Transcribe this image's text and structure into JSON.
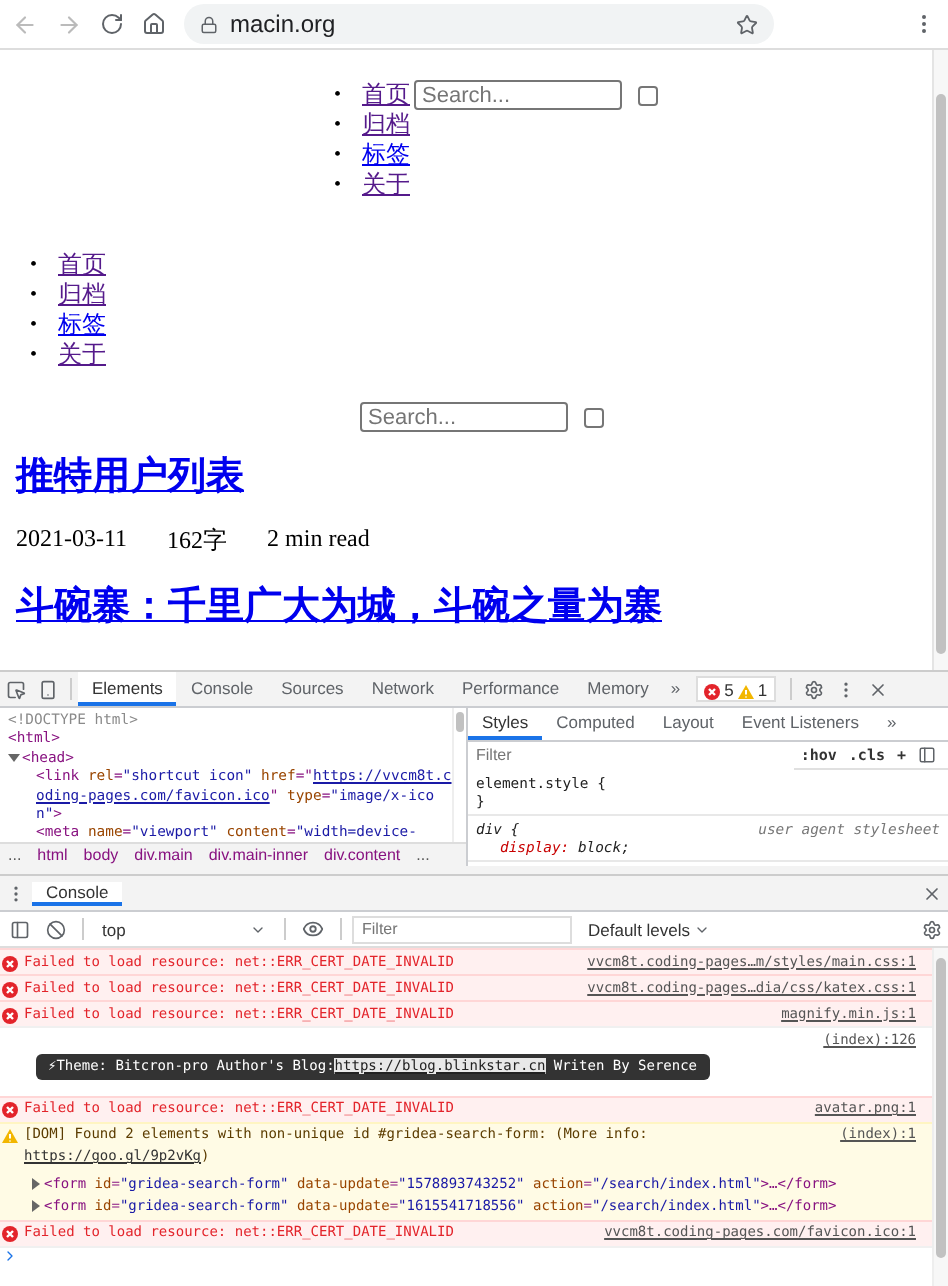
{
  "browser": {
    "address": "macin.org"
  },
  "page": {
    "header_nav": {
      "links": [
        {
          "marker": "•",
          "label": "首页",
          "visited": true
        },
        {
          "marker": "•",
          "label": "归档",
          "visited": true
        },
        {
          "marker": "•",
          "label": "标签",
          "visited": false
        },
        {
          "marker": "•",
          "label": "关于",
          "visited": true
        }
      ],
      "search": {
        "placeholder": "Search...",
        "checked": false
      }
    },
    "menu": {
      "links": [
        {
          "marker": "•",
          "label": "首页",
          "visited": true
        },
        {
          "marker": "•",
          "label": "归档",
          "visited": true
        },
        {
          "marker": "•",
          "label": "标签",
          "visited": false
        },
        {
          "marker": "•",
          "label": "关于",
          "visited": true
        }
      ]
    },
    "search": {
      "placeholder": "Search...",
      "checked": false
    },
    "posts": [
      {
        "title": "推特用户列表",
        "date": "2021-03-11",
        "words": "162字",
        "read_time": "2 min read"
      },
      {
        "title": "斗碗寨：千里广大为城，斗碗之量为寨"
      }
    ]
  },
  "devtools": {
    "tabs": [
      {
        "label": "Elements",
        "selected": true
      },
      {
        "label": "Console",
        "selected": false
      },
      {
        "label": "Sources",
        "selected": false
      },
      {
        "label": "Network",
        "selected": false
      },
      {
        "label": "Performance",
        "selected": false
      },
      {
        "label": "Memory",
        "selected": false
      }
    ],
    "overflow": "»",
    "error_count": "5",
    "warning_count": "1",
    "dom": [
      {
        "tokens": [
          {
            "kind": "comment",
            "text": "<!DOCTYPE html>"
          }
        ]
      },
      {
        "tokens": [
          {
            "kind": "tag",
            "text": "<html>"
          }
        ],
        "children": [
          {
            "tokens": [
              {
                "kind": "tag",
                "text": "<head>"
              }
            ],
            "expanded": true,
            "children": [
              {
                "tokens": [
                  {
                    "kind": "tag",
                    "text": "<link"
                  },
                  {
                    "kind": "attr",
                    "text": " rel"
                  },
                  {
                    "kind": "tag",
                    "text": "="
                  },
                  {
                    "kind": "value",
                    "text": "\"shortcut icon\""
                  },
                  {
                    "kind": "attr",
                    "text": " href"
                  },
                  {
                    "kind": "tag",
                    "text": "=\""
                  },
                  {
                    "kind": "link",
                    "text": "https://vvcm8t.coding-pages.com/favicon.ico"
                  },
                  {
                    "kind": "tag",
                    "text": "\""
                  },
                  {
                    "kind": "attr",
                    "text": " type"
                  },
                  {
                    "kind": "tag",
                    "text": "="
                  },
                  {
                    "kind": "value",
                    "text": "\"image/x-icon\""
                  },
                  {
                    "kind": "tag",
                    "text": ">"
                  }
                ]
              },
              {
                "tokens": [
                  {
                    "kind": "tag",
                    "text": "<meta"
                  },
                  {
                    "kind": "attr",
                    "text": " name"
                  },
                  {
                    "kind": "tag",
                    "text": "="
                  },
                  {
                    "kind": "value",
                    "text": "\"viewport\""
                  },
                  {
                    "kind": "attr",
                    "text": " content"
                  },
                  {
                    "kind": "tag",
                    "text": "="
                  },
                  {
                    "kind": "value",
                    "text": "\"width=device-"
                  }
                ]
              }
            ]
          }
        ]
      }
    ],
    "breadcrumbs": [
      "...",
      "html",
      "body",
      "div.main",
      "div.main-inner",
      "div.content",
      "..."
    ],
    "side_tabs": [
      {
        "label": "Styles",
        "selected": true
      },
      {
        "label": "Computed",
        "selected": false
      },
      {
        "label": "Layout",
        "selected": false
      },
      {
        "label": "Event Listeners",
        "selected": false
      }
    ],
    "side_overflow": "»",
    "styles_filter": {
      "placeholder": "Filter"
    },
    "styles_actions": [
      ":hov",
      ".cls",
      "+"
    ],
    "rules": [
      {
        "open": "element.style {",
        "close": "}"
      },
      {
        "open": "div {",
        "source": "user agent stylesheet",
        "declarations": [
          {
            "property": "display:",
            "value": "block;"
          }
        ]
      }
    ]
  },
  "console": {
    "tabs": [
      {
        "label": "Console",
        "selected": true
      }
    ],
    "context": "top",
    "filter": {
      "placeholder": "Filter"
    },
    "levels": "Default levels",
    "messages": [
      {
        "kind": "error",
        "text": "Failed to load resource: net::ERR_CERT_DATE_INVALID",
        "source": "vvcm8t.coding-pages…m/styles/main.css:1"
      },
      {
        "kind": "error",
        "text": "Failed to load resource: net::ERR_CERT_DATE_INVALID",
        "source": "vvcm8t.coding-pages…dia/css/katex.css:1"
      },
      {
        "kind": "error",
        "text": "Failed to load resource: net::ERR_CERT_DATE_INVALID",
        "source": "magnify.min.js:1"
      },
      {
        "kind": "styled_log",
        "source": "(index):126",
        "segments": [
          {
            "text": "⚡Theme: Bitcron-pro Author's Blog:",
            "link": false
          },
          {
            "text": "https://blog.blinkstar.cn",
            "link": true
          },
          {
            "text": " Writen By Serence",
            "link": false
          }
        ]
      },
      {
        "kind": "error",
        "text": "Failed to load resource: net::ERR_CERT_DATE_INVALID",
        "source": "avatar.png:1"
      },
      {
        "kind": "warning",
        "text": "[DOM] Found 2 elements with non-unique id #gridea-search-form: (More info:",
        "link": "https://goo.gl/9p2vKg",
        "text_after": ")",
        "source": "(index):1",
        "children": [
          {
            "expanded": false,
            "tokens": [
              {
                "kind": "tag",
                "text": "<form"
              },
              {
                "kind": "attr",
                "text": " id"
              },
              {
                "kind": "tag",
                "text": "="
              },
              {
                "kind": "value",
                "text": "\"gridea-search-form\""
              },
              {
                "kind": "attr",
                "text": " data-update"
              },
              {
                "kind": "tag",
                "text": "="
              },
              {
                "kind": "value",
                "text": "\"1578893743252\""
              },
              {
                "kind": "attr",
                "text": " action"
              },
              {
                "kind": "tag",
                "text": "="
              },
              {
                "kind": "value",
                "text": "\"/search/index.html\""
              },
              {
                "kind": "tag",
                "text": ">…</form>"
              }
            ]
          },
          {
            "expanded": false,
            "tokens": [
              {
                "kind": "tag",
                "text": "<form"
              },
              {
                "kind": "attr",
                "text": " id"
              },
              {
                "kind": "tag",
                "text": "="
              },
              {
                "kind": "value",
                "text": "\"gridea-search-form\""
              },
              {
                "kind": "attr",
                "text": " data-update"
              },
              {
                "kind": "tag",
                "text": "="
              },
              {
                "kind": "value",
                "text": "\"1615541718556\""
              },
              {
                "kind": "attr",
                "text": " action"
              },
              {
                "kind": "tag",
                "text": "="
              },
              {
                "kind": "value",
                "text": "\"/search/index.html\""
              },
              {
                "kind": "tag",
                "text": ">…</form>"
              }
            ]
          }
        ]
      },
      {
        "kind": "error",
        "text": "Failed to load resource: net::ERR_CERT_DATE_INVALID",
        "source": "vvcm8t.coding-pages.com/favicon.ico:1"
      }
    ]
  }
}
